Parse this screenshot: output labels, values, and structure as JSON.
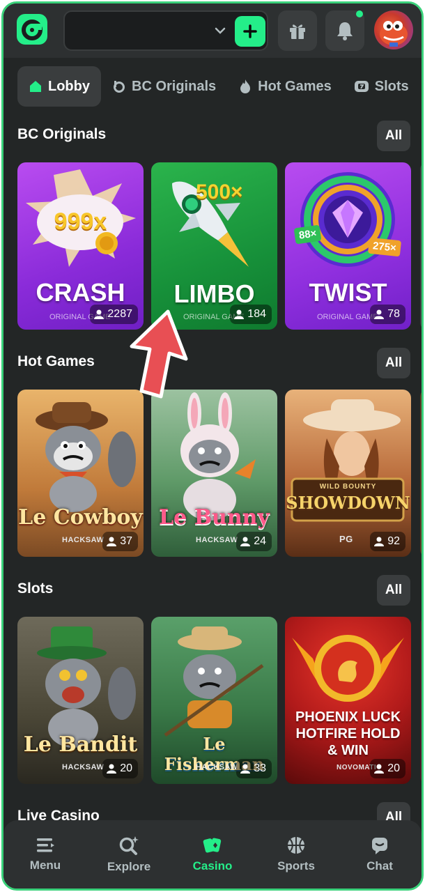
{
  "header": {
    "balance_value": "",
    "icons": [
      "logo-icon",
      "chevron-down-icon",
      "plus-icon",
      "gift-icon",
      "bell-icon",
      "avatar"
    ]
  },
  "tabs": [
    {
      "label": "Lobby",
      "icon": "home-icon",
      "active": true
    },
    {
      "label": "BC Originals",
      "icon": "bc-icon",
      "active": false
    },
    {
      "label": "Hot Games",
      "icon": "flame-icon",
      "active": false
    },
    {
      "label": "Slots",
      "icon": "slot-icon",
      "active": false
    }
  ],
  "sections": {
    "originals": {
      "title": "BC Originals",
      "all_label": "All",
      "cards": [
        {
          "name": "CRASH",
          "badge": "999x",
          "subtitle": "ORIGINAL GAME",
          "players": "2287"
        },
        {
          "name": "LIMBO",
          "badge": "500×",
          "subtitle": "ORIGINAL GAME",
          "players": "184"
        },
        {
          "name": "TWIST",
          "badge_left": "88×",
          "badge_right": "275×",
          "subtitle": "ORIGINAL GAME",
          "players": "78"
        }
      ]
    },
    "hot": {
      "title": "Hot Games",
      "all_label": "All",
      "cards": [
        {
          "name": "Le Cowboy",
          "provider": "HACKSAW",
          "players": "37"
        },
        {
          "name": "Le Bunny",
          "provider": "HACKSAW",
          "players": "24"
        },
        {
          "name": "SHOWDOWN",
          "tagline": "WILD BOUNTY",
          "provider": "PG",
          "players": "92"
        }
      ]
    },
    "slots": {
      "title": "Slots",
      "all_label": "All",
      "cards": [
        {
          "name": "Le Bandit",
          "provider": "HACKSAW",
          "players": "20"
        },
        {
          "name": "Le Fisherman",
          "provider": "HACKSAW",
          "players": "33"
        },
        {
          "name": "PHOENIX LUCK HOTFIRE HOLD & WIN",
          "provider": "NOVOMATIC",
          "players": "20"
        }
      ]
    },
    "live": {
      "title": "Live Casino",
      "all_label": "All"
    }
  },
  "bottom_nav": [
    {
      "label": "Menu",
      "icon": "menu-icon",
      "active": false
    },
    {
      "label": "Explore",
      "icon": "explore-icon",
      "active": false
    },
    {
      "label": "Casino",
      "icon": "casino-cards-icon",
      "active": true
    },
    {
      "label": "Sports",
      "icon": "basketball-icon",
      "active": false
    },
    {
      "label": "Chat",
      "icon": "chat-icon",
      "active": false
    }
  ],
  "colors": {
    "accent": "#24ee89",
    "background": "#232626",
    "surface": "#2d3031",
    "chip": "#3a3d3e",
    "arrow": "#e84f54"
  }
}
